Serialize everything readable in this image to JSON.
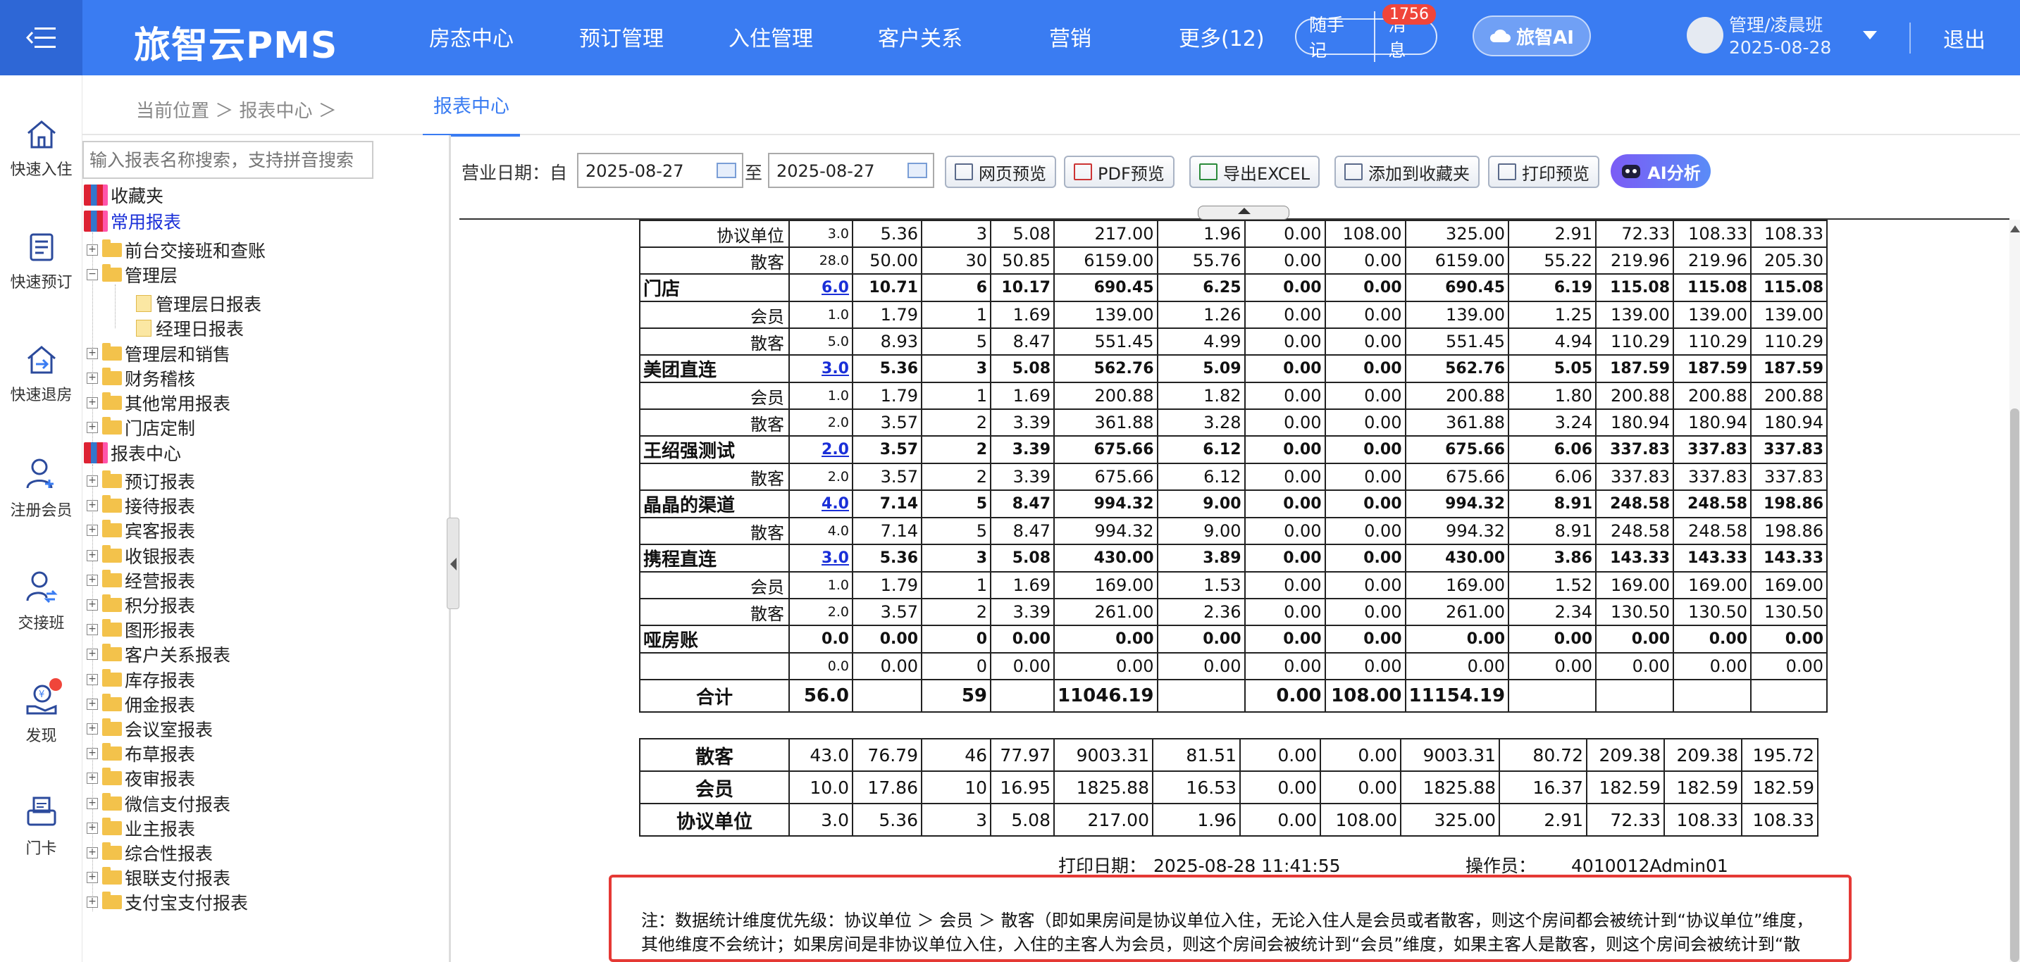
{
  "header": {
    "brand": "旅智云PMS",
    "nav": [
      "房态中心",
      "预订管理",
      "入住管理",
      "客户关系",
      "营销",
      "更多(12)"
    ],
    "memo_label": "随手记",
    "message_label": "消息",
    "message_badge": "1756",
    "ai_label": "旅智AI",
    "user_name": "管理/凌晨班",
    "user_date": "2025-08-28",
    "logout_label": "退出"
  },
  "sidebar": {
    "items": [
      "快速入住",
      "快速预订",
      "快速退房",
      "注册会员",
      "交接班",
      "发现",
      "门卡"
    ]
  },
  "breadcrumb": {
    "text": "当前位置 ＞ 报表中心 ＞",
    "active_tab": "报表中心"
  },
  "tree": {
    "search_placeholder": "输入报表名称搜索，支持拼音搜索",
    "favorites": "收藏夹",
    "common": "常用报表",
    "common_children": [
      "前台交接班和查账",
      "管理层"
    ],
    "mgmt_children": [
      "管理层日报表",
      "经理日报表"
    ],
    "common_rest": [
      "管理层和销售",
      "财务稽核",
      "其他常用报表",
      "门店定制"
    ],
    "center": "报表中心",
    "center_children": [
      "预订报表",
      "接待报表",
      "宾客报表",
      "收银报表",
      "经营报表",
      "积分报表",
      "图形报表",
      "客户关系报表",
      "库存报表",
      "佣金报表",
      "会议室报表",
      "布草报表",
      "夜审报表",
      "微信支付报表",
      "业主报表",
      "综合性报表",
      "银联支付报表",
      "支付宝支付报表"
    ]
  },
  "toolbar": {
    "date_label": "营业日期：自",
    "date_from": "2025-08-27",
    "to_label": "至",
    "date_to": "2025-08-27",
    "buttons": [
      "网页预览",
      "PDF预览",
      "导出EXCEL",
      "添加到收藏夹",
      "打印预览"
    ],
    "ai_analysis": "AI分析"
  },
  "report": {
    "rows": [
      {
        "type": "sub",
        "name": "协议单位",
        "c": [
          "3.0",
          "5.36",
          "3",
          "5.08",
          "217.00",
          "1.96",
          "0.00",
          "108.00",
          "325.00",
          "2.91",
          "72.33",
          "108.33",
          "108.33"
        ]
      },
      {
        "type": "sub",
        "name": "散客",
        "c": [
          "28.0",
          "50.00",
          "30",
          "50.85",
          "6159.00",
          "55.76",
          "0.00",
          "0.00",
          "6159.00",
          "55.22",
          "219.96",
          "219.96",
          "205.30"
        ]
      },
      {
        "type": "grp",
        "name": "门店",
        "c": [
          "6.0",
          "10.71",
          "6",
          "10.17",
          "690.45",
          "6.25",
          "0.00",
          "0.00",
          "690.45",
          "6.19",
          "115.08",
          "115.08",
          "115.08"
        ]
      },
      {
        "type": "sub",
        "name": "会员",
        "c": [
          "1.0",
          "1.79",
          "1",
          "1.69",
          "139.00",
          "1.26",
          "0.00",
          "0.00",
          "139.00",
          "1.25",
          "139.00",
          "139.00",
          "139.00"
        ]
      },
      {
        "type": "sub",
        "name": "散客",
        "c": [
          "5.0",
          "8.93",
          "5",
          "8.47",
          "551.45",
          "4.99",
          "0.00",
          "0.00",
          "551.45",
          "4.94",
          "110.29",
          "110.29",
          "110.29"
        ]
      },
      {
        "type": "grp",
        "name": "美团直连",
        "c": [
          "3.0",
          "5.36",
          "3",
          "5.08",
          "562.76",
          "5.09",
          "0.00",
          "0.00",
          "562.76",
          "5.05",
          "187.59",
          "187.59",
          "187.59"
        ]
      },
      {
        "type": "sub",
        "name": "会员",
        "c": [
          "1.0",
          "1.79",
          "1",
          "1.69",
          "200.88",
          "1.82",
          "0.00",
          "0.00",
          "200.88",
          "1.80",
          "200.88",
          "200.88",
          "200.88"
        ]
      },
      {
        "type": "sub",
        "name": "散客",
        "c": [
          "2.0",
          "3.57",
          "2",
          "3.39",
          "361.88",
          "3.28",
          "0.00",
          "0.00",
          "361.88",
          "3.24",
          "180.94",
          "180.94",
          "180.94"
        ]
      },
      {
        "type": "grp",
        "name": "王绍强测试",
        "c": [
          "2.0",
          "3.57",
          "2",
          "3.39",
          "675.66",
          "6.12",
          "0.00",
          "0.00",
          "675.66",
          "6.06",
          "337.83",
          "337.83",
          "337.83"
        ]
      },
      {
        "type": "sub",
        "name": "散客",
        "c": [
          "2.0",
          "3.57",
          "2",
          "3.39",
          "675.66",
          "6.12",
          "0.00",
          "0.00",
          "675.66",
          "6.06",
          "337.83",
          "337.83",
          "337.83"
        ]
      },
      {
        "type": "grp",
        "name": "晶晶的渠道",
        "c": [
          "4.0",
          "7.14",
          "5",
          "8.47",
          "994.32",
          "9.00",
          "0.00",
          "0.00",
          "994.32",
          "8.91",
          "248.58",
          "248.58",
          "198.86"
        ]
      },
      {
        "type": "sub",
        "name": "散客",
        "c": [
          "4.0",
          "7.14",
          "5",
          "8.47",
          "994.32",
          "9.00",
          "0.00",
          "0.00",
          "994.32",
          "8.91",
          "248.58",
          "248.58",
          "198.86"
        ]
      },
      {
        "type": "grp",
        "name": "携程直连",
        "c": [
          "3.0",
          "5.36",
          "3",
          "5.08",
          "430.00",
          "3.89",
          "0.00",
          "0.00",
          "430.00",
          "3.86",
          "143.33",
          "143.33",
          "143.33"
        ]
      },
      {
        "type": "sub",
        "name": "会员",
        "c": [
          "1.0",
          "1.79",
          "1",
          "1.69",
          "169.00",
          "1.53",
          "0.00",
          "0.00",
          "169.00",
          "1.52",
          "169.00",
          "169.00",
          "169.00"
        ]
      },
      {
        "type": "sub",
        "name": "散客",
        "c": [
          "2.0",
          "3.57",
          "2",
          "3.39",
          "261.00",
          "2.36",
          "0.00",
          "0.00",
          "261.00",
          "2.34",
          "130.50",
          "130.50",
          "130.50"
        ]
      },
      {
        "type": "grpnl",
        "name": "哑房账",
        "c": [
          "0.0",
          "0.00",
          "0",
          "0.00",
          "0.00",
          "0.00",
          "0.00",
          "0.00",
          "0.00",
          "0.00",
          "0.00",
          "0.00",
          "0.00"
        ]
      },
      {
        "type": "sub",
        "name": "",
        "c": [
          "0.0",
          "0.00",
          "0",
          "0.00",
          "0.00",
          "0.00",
          "0.00",
          "0.00",
          "0.00",
          "0.00",
          "0.00",
          "0.00",
          "0.00"
        ]
      }
    ],
    "total": {
      "name": "合计",
      "c": [
        "56.0",
        "",
        "59",
        "",
        "11046.19",
        "",
        "0.00",
        "108.00",
        "11154.19",
        "",
        "",
        "",
        ""
      ]
    },
    "summary": [
      {
        "name": "散客",
        "c": [
          "43.0",
          "76.79",
          "46",
          "77.97",
          "9003.31",
          "81.51",
          "0.00",
          "0.00",
          "9003.31",
          "80.72",
          "209.38",
          "209.38",
          "195.72"
        ]
      },
      {
        "name": "会员",
        "c": [
          "10.0",
          "17.86",
          "10",
          "16.95",
          "1825.88",
          "16.53",
          "0.00",
          "0.00",
          "1825.88",
          "16.37",
          "182.59",
          "182.59",
          "182.59"
        ]
      },
      {
        "name": "协议单位",
        "c": [
          "3.0",
          "5.36",
          "3",
          "5.08",
          "217.00",
          "1.96",
          "0.00",
          "108.00",
          "325.00",
          "2.91",
          "72.33",
          "108.33",
          "108.33"
        ]
      }
    ]
  },
  "footer": {
    "print_date_label": "打印日期：",
    "print_date": "2025-08-28 11:41:55",
    "operator_label": "操作员：",
    "operator": "4010012Admin01",
    "note": "注：数据统计维度优先级：协议单位 ＞ 会员 ＞ 散客（即如果房间是协议单位入住，无论入住人是会员或者散客，则这个房间都会被统计到“协议单位”维度，其他维度不会统计；如果房间是非协议单位入住，入住的主客人为会员，则这个房间会被统计到“会员”维度，如果主客人是散客，则这个房间会被统计到“散客”维度。"
  }
}
